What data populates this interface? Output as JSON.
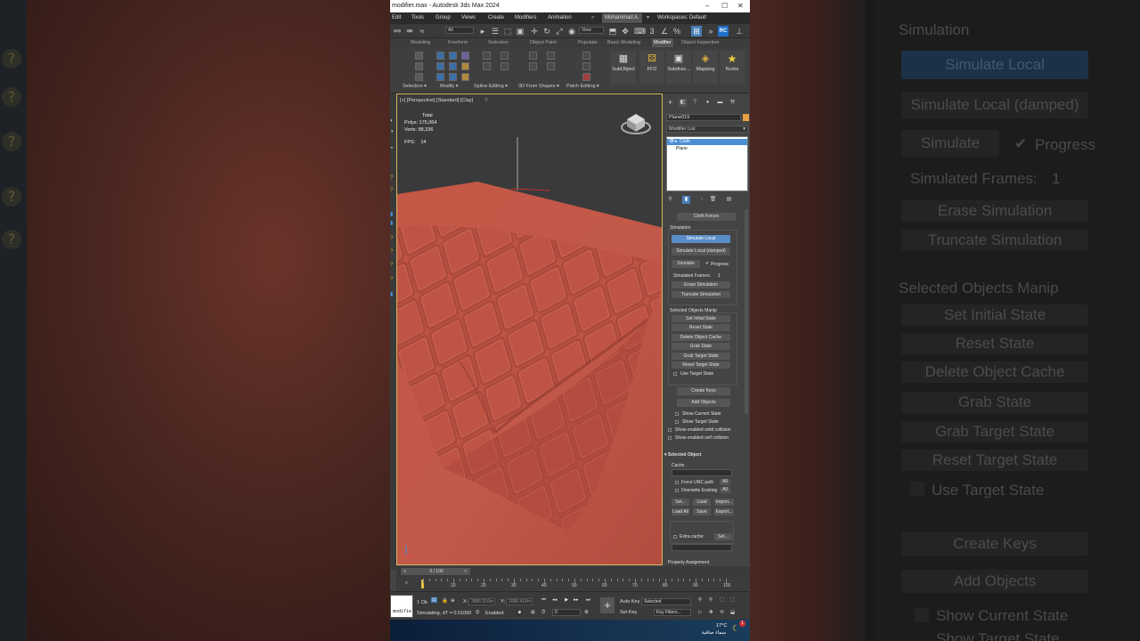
{
  "window": {
    "title": "modifier.max - Autodesk 3ds Max 2024",
    "minimize": "–",
    "maximize": "☐",
    "close": "✕"
  },
  "menu": {
    "items": [
      "Edit",
      "Tools",
      "Group",
      "Views",
      "Create",
      "Modifiers",
      "Animation"
    ],
    "user": "Mohammad A.",
    "workspace_label": "Workspaces:",
    "workspace_value": "Default"
  },
  "toolbar": {
    "filter_value": "All",
    "view_value": "View",
    "rc_label": "RC"
  },
  "ribbon": {
    "tabs": [
      "Modeling",
      "Freeform",
      "Selection",
      "Object Paint",
      "Populate",
      "Basic Modeling",
      "Modifier",
      "Object Inspection"
    ],
    "big_buttons": [
      "SubObject",
      "FFD",
      "Subdivis...",
      "Mapping",
      "Nurbs"
    ],
    "footer": [
      "Selection ▾",
      "Modify ▾",
      "Spline Editing ▾",
      "3D From Shapes ▾",
      "Patch Editing ▾"
    ]
  },
  "viewport": {
    "label": "[+] [Perspective] [Standard] [Clay]",
    "stats_total": "Total",
    "polys_label": "Polys:",
    "polys_value": "175,064",
    "verts_label": "Verts:",
    "verts_value": "88,336",
    "fps_label": "FPS:",
    "fps_value": "14",
    "colors": {
      "cloth": "#c65848",
      "background": "#3a3a3a",
      "border": "#d9b560"
    }
  },
  "command_panel": {
    "object_name": "Plane019",
    "modifier_list": "Modifier List",
    "stack": [
      "Cloth",
      "Plane"
    ],
    "cloth_forces": "Cloth Forces",
    "simulation_header": "Simulation",
    "simulate_local": "Simulate Local",
    "simulate_local_damped": "Simulate Local (damped)",
    "simulate": "Simulate",
    "progress_label": "Progress",
    "simulated_frames_label": "Simulated Frames:",
    "simulated_frames_value": "1",
    "erase_simulation": "Erase Simulation",
    "truncate_simulation": "Truncate Simulation",
    "selected_objects_manip": "Selected Objects Manip",
    "set_initial_state": "Set Initial State",
    "reset_state": "Reset State",
    "delete_object_cache": "Delete Object Cache",
    "grab_state": "Grab State",
    "grab_target_state": "Grab Target State",
    "reset_target_state": "Reset Target State",
    "use_target_state": "Use Target State",
    "create_keys": "Create Keys",
    "add_objects": "Add Objects",
    "show_current_state": "Show Current State",
    "show_target_state": "Show Target State",
    "show_enabled_solid_collision": "Show enabled solid collision",
    "show_enabled_self_collision": "Show enabled self collision",
    "selected_object_header": "Selected Object",
    "cache_label": "Cache",
    "force_unc_path": "Force UNC path",
    "overwrite_existing": "Overwrite Existing",
    "all": "All",
    "set": "Set...",
    "load": "Load",
    "import": "Import...",
    "load_all": "Load All",
    "save": "Save",
    "export": "Export...",
    "extra_cache": "Extra cache:",
    "property_assignment": "Property Assignment"
  },
  "timeline": {
    "slider": "0 / 100",
    "prev": "<",
    "next": ">",
    "ticks": [
      "10",
      "20",
      "30",
      "40",
      "50",
      "60",
      "70",
      "80",
      "90",
      "100"
    ]
  },
  "status": {
    "selected_count": "1 Ob",
    "x_label": "X:",
    "x_value": "2896.916m",
    "y_label": "Y:",
    "y_value": "2096.416m",
    "message": "Simulating, dT = 0.01000",
    "enabled_label": "Enabled:",
    "frame_value": "0",
    "autokey": "Auto Key",
    "selected_dropdown": "Selected",
    "setkey": "Set Key",
    "keyfilters": "Key Filters...",
    "script_box": "modifie"
  },
  "taskbar": {
    "temp": "17°C",
    "weather": "سماء صافية",
    "badge": "1"
  },
  "background_right": {
    "simulation": "Simulation",
    "simulate_local": "Simulate Local",
    "simulate_local_damped": "Simulate Local (damped)",
    "simulate": "Simulate",
    "progress": "Progress",
    "simulated_frames": "Simulated Frames:",
    "simulated_frames_value": "1",
    "erase_simulation": "Erase Simulation",
    "truncate_simulation": "Truncate Simulation",
    "selected_objects_manip": "Selected Objects Manip",
    "set_initial_state": "Set Initial State",
    "reset_state": "Reset State",
    "delete_object_cache": "Delete Object Cache",
    "grab_state": "Grab State",
    "grab_target_state": "Grab Target State",
    "reset_target_state": "Reset Target State",
    "use_target_state": "Use Target State",
    "create_keys": "Create Keys",
    "add_objects": "Add Objects",
    "show_current_state": "Show Current State",
    "show_target_state": "Show Target State"
  }
}
